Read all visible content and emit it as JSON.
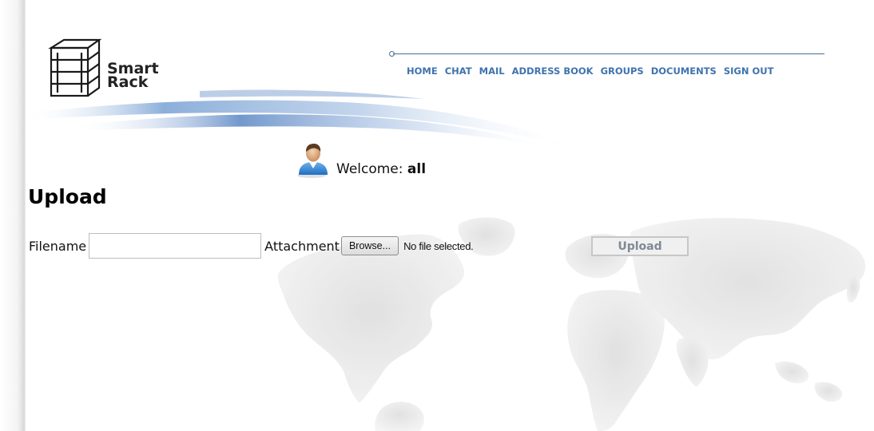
{
  "logo": {
    "line1": "Smart",
    "line2": "Rack"
  },
  "nav": {
    "items": [
      "HOME",
      "CHAT",
      "MAIL",
      "ADDRESS BOOK",
      "GROUPS",
      "DOCUMENTS",
      "SIGN OUT"
    ],
    "color": "#3f73ad"
  },
  "welcome": {
    "label": "Welcome:",
    "user": "all"
  },
  "page": {
    "title": "Upload"
  },
  "form": {
    "filename_label": "Filename",
    "filename_value": "",
    "attachment_label": "Attachment",
    "browse_label": "Browse...",
    "no_file_text": "No file selected.",
    "upload_label": "Upload"
  },
  "icons": {
    "logo": "rack-shelf-icon",
    "avatar": "user-avatar-icon"
  }
}
